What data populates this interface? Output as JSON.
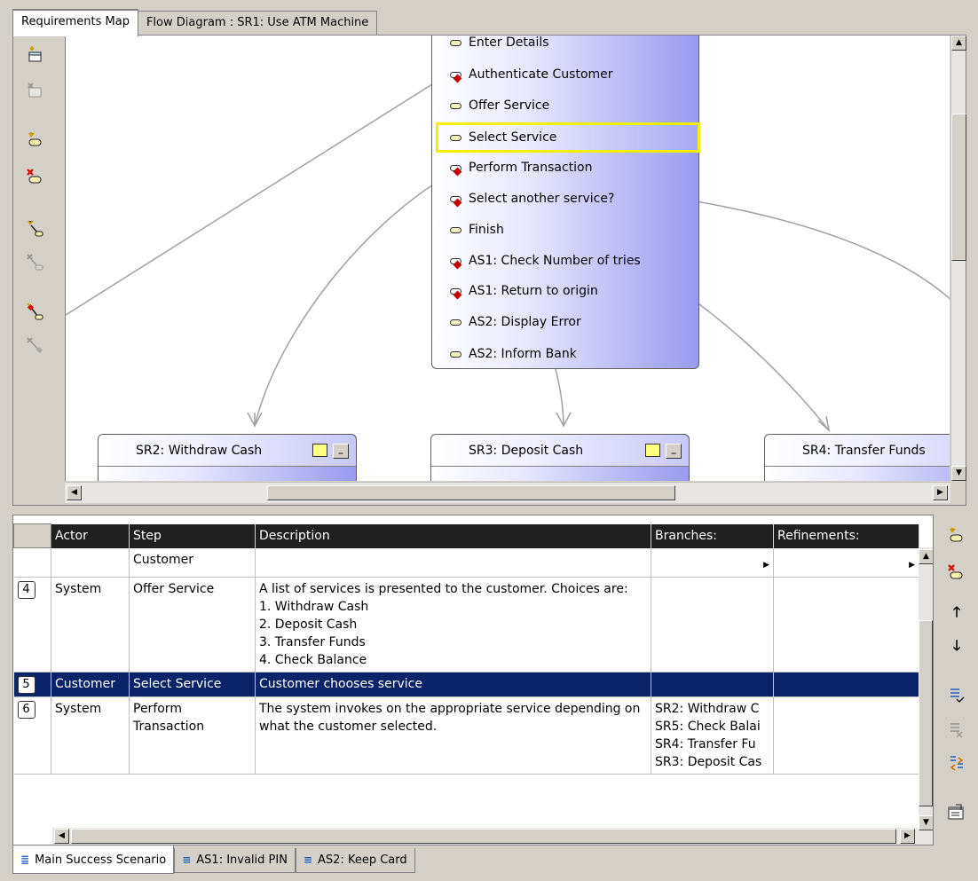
{
  "top_tabs": [
    "Requirements Map",
    "Flow Diagram : SR1: Use ATM Machine"
  ],
  "flow_steps": [
    {
      "label": "Enter Details",
      "type": "plain"
    },
    {
      "label": "Authenticate Customer",
      "type": "branch"
    },
    {
      "label": "Offer Service",
      "type": "plain"
    },
    {
      "label": "Select Service",
      "type": "plain",
      "selected": true
    },
    {
      "label": "Perform Transaction",
      "type": "branch"
    },
    {
      "label": "Select another service?",
      "type": "branch"
    },
    {
      "label": "Finish",
      "type": "plain"
    },
    {
      "label": "AS1: Check Number of tries",
      "type": "branch"
    },
    {
      "label": "AS1: Return to origin",
      "type": "branch"
    },
    {
      "label": "AS2: Display Error",
      "type": "plain"
    },
    {
      "label": "AS2: Inform Bank",
      "type": "plain"
    }
  ],
  "sr_boxes": [
    "SR2: Withdraw Cash",
    "SR3: Deposit Cash",
    "SR4: Transfer Funds"
  ],
  "grid": {
    "headers": [
      "",
      "Actor",
      "Step",
      "Description",
      "Branches:",
      "Refinements:"
    ],
    "rows": [
      {
        "num": "",
        "actor": "",
        "step": "Customer",
        "description": "",
        "branches": [],
        "partial": true
      },
      {
        "num": "4",
        "actor": "System",
        "step": "Offer Service",
        "description_lines": [
          "A list of services is presented to the customer. Choices are:",
          "1. Withdraw Cash",
          "2. Deposit Cash",
          "3. Transfer Funds",
          "4. Check Balance"
        ],
        "branches": []
      },
      {
        "num": "5",
        "actor": "Customer",
        "step": "Select Service",
        "description_lines": [
          "Customer chooses service"
        ],
        "branches": [],
        "selected": true
      },
      {
        "num": "6",
        "actor": "System",
        "step": "Perform Transaction",
        "description_lines": [
          "The system invokes on the appropriate service depending on what the customer selected."
        ],
        "branches": [
          "SR2: Withdraw C",
          "SR5: Check Balai",
          "SR4: Transfer Fu",
          "SR3: Deposit Cas"
        ]
      }
    ]
  },
  "bottom_tabs": [
    "Main Success Scenario",
    "AS1: Invalid PIN",
    "AS2: Keep Card"
  ],
  "left_toolbar_icons": [
    "add-requirement-icon",
    "delete-requirement-icon",
    "add-step-icon",
    "delete-step-icon",
    "add-link-icon",
    "remove-link-icon",
    "add-branch-link-icon",
    "remove-branch-link-icon"
  ],
  "right_toolbar_icons": [
    "add-step-icon",
    "delete-step-icon",
    "move-up-icon",
    "move-down-icon",
    "add-branch-icon",
    "remove-branch-icon",
    "swap-branch-icon",
    "properties-icon"
  ]
}
